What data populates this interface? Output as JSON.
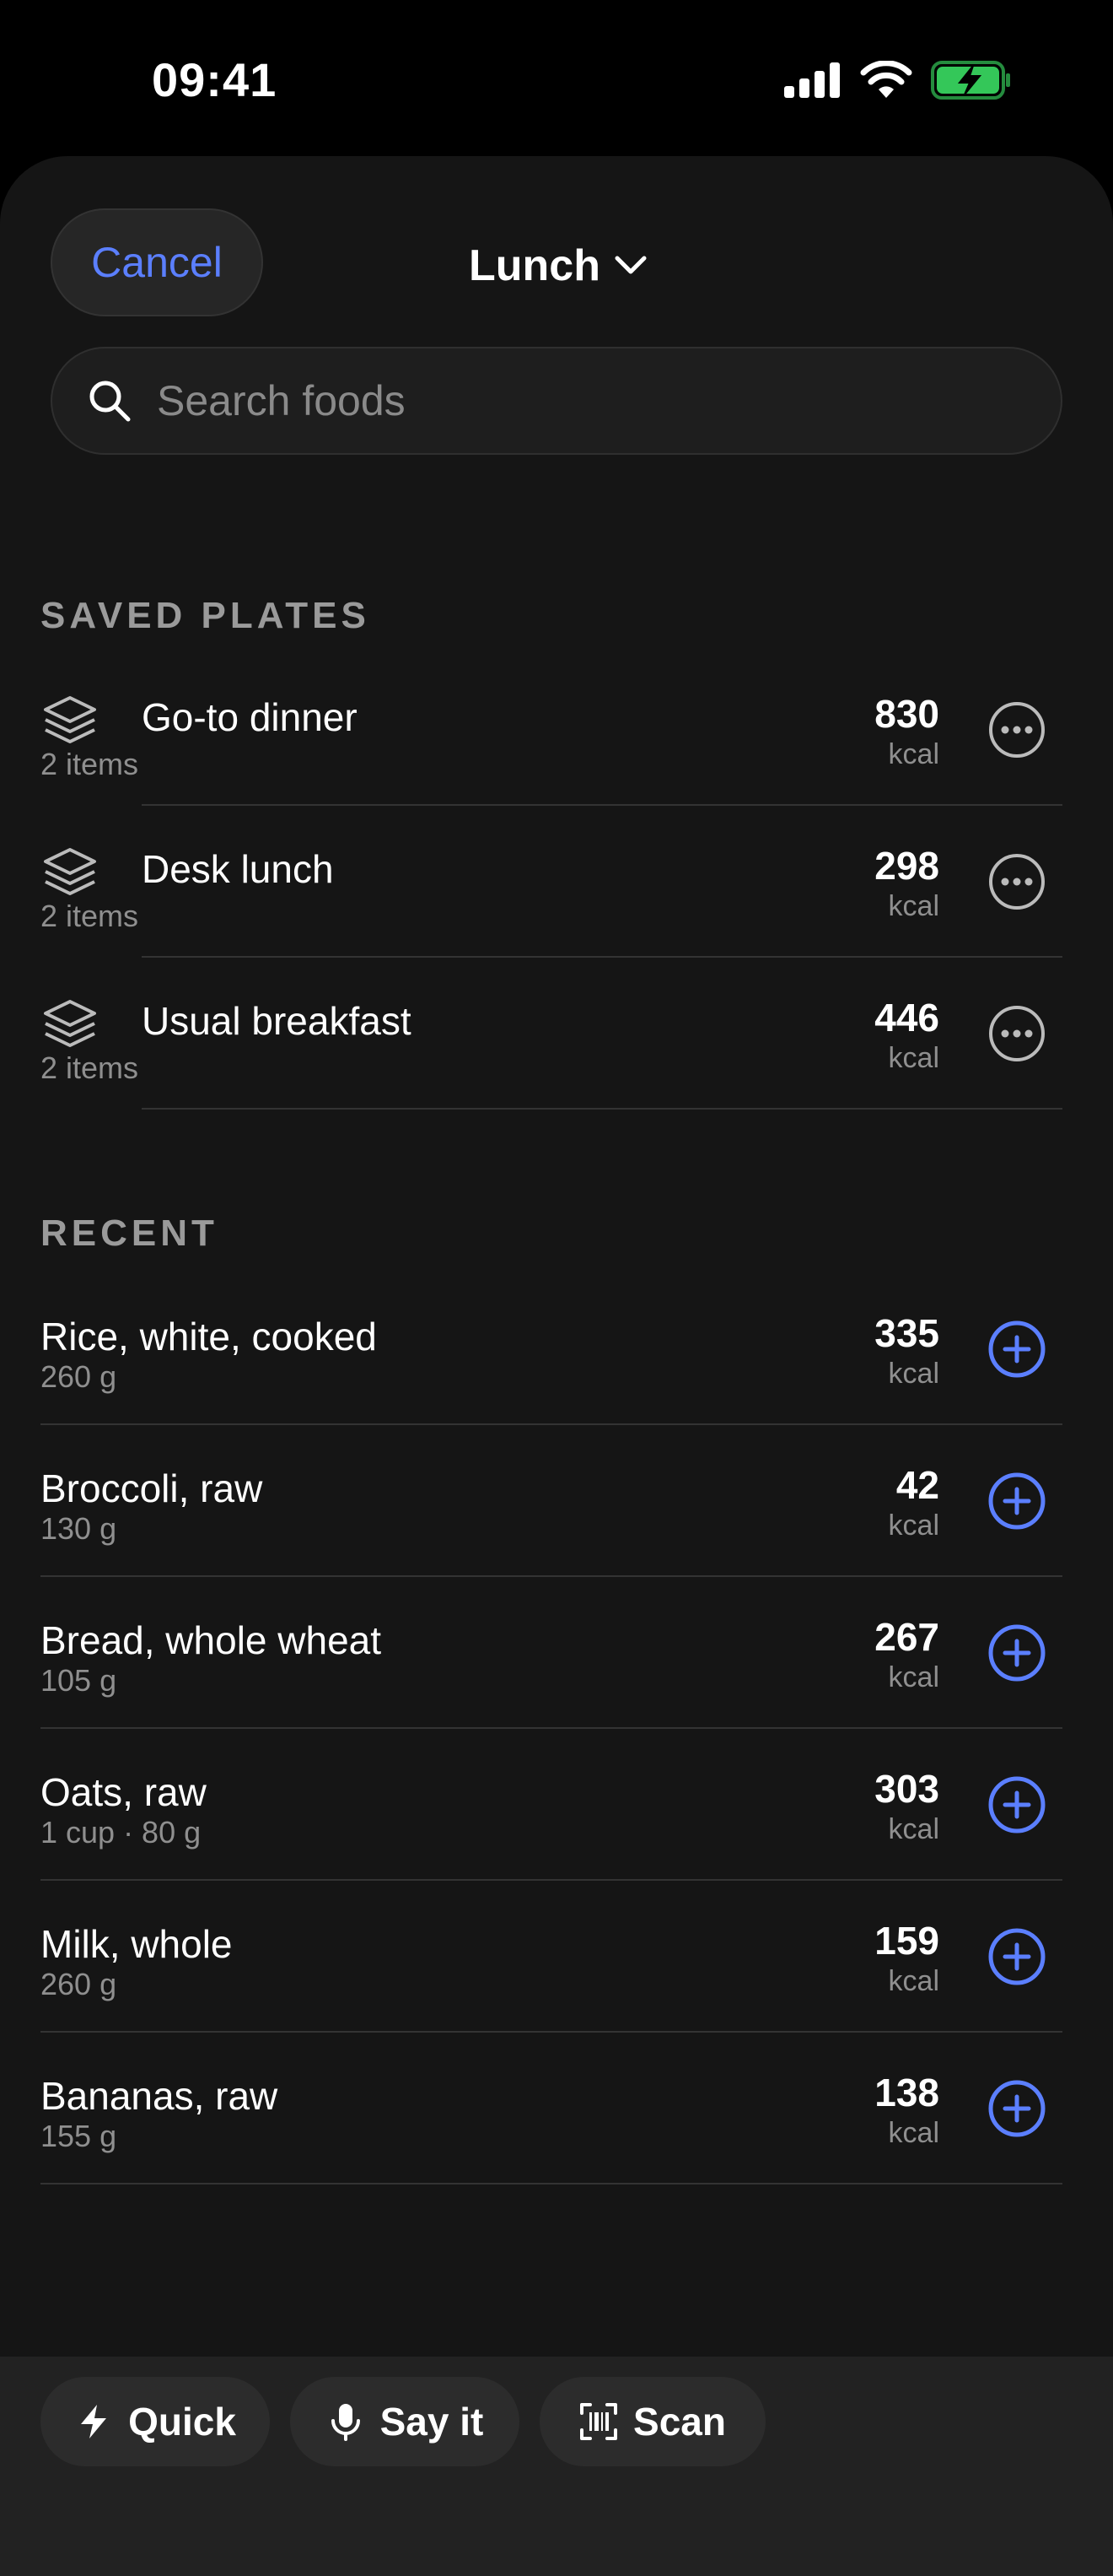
{
  "status_bar": {
    "time": "09:41"
  },
  "header": {
    "cancel_label": "Cancel",
    "meal": "Lunch"
  },
  "search": {
    "placeholder": "Search foods"
  },
  "saved_plates": {
    "title": "SAVED PLATES",
    "items": [
      {
        "name": "Go-to dinner",
        "count": "2 items",
        "kcal": "830",
        "unit": "kcal"
      },
      {
        "name": "Desk lunch",
        "count": "2 items",
        "kcal": "298",
        "unit": "kcal"
      },
      {
        "name": "Usual breakfast",
        "count": "2 items",
        "kcal": "446",
        "unit": "kcal"
      }
    ]
  },
  "recent": {
    "title": "RECENT",
    "items": [
      {
        "name": "Rice, white, cooked",
        "amount": "260 g",
        "kcal": "335",
        "unit": "kcal"
      },
      {
        "name": "Broccoli, raw",
        "amount": "130 g",
        "kcal": "42",
        "unit": "kcal"
      },
      {
        "name": "Bread, whole wheat",
        "amount": "105 g",
        "kcal": "267",
        "unit": "kcal"
      },
      {
        "name": "Oats, raw",
        "amount": "1 cup · 80 g",
        "kcal": "303",
        "unit": "kcal"
      },
      {
        "name": "Milk, whole",
        "amount": "260 g",
        "kcal": "159",
        "unit": "kcal"
      },
      {
        "name": "Bananas, raw",
        "amount": "155 g",
        "kcal": "138",
        "unit": "kcal"
      }
    ]
  },
  "bottom_actions": {
    "quick_label": "Quick",
    "say_label": "Say it",
    "scan_label": "Scan"
  },
  "colors": {
    "accent": "#5b7fff",
    "battery": "#34c759"
  }
}
